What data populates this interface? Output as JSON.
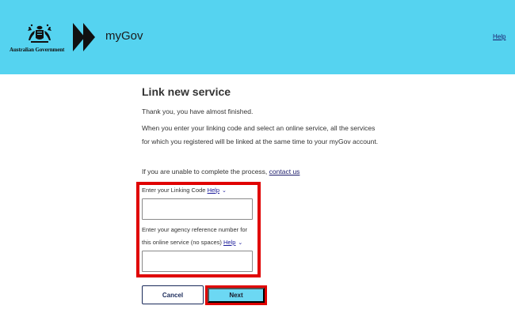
{
  "header": {
    "gov_label": "Australian Government",
    "brand": "myGov",
    "help_label": "Help"
  },
  "main": {
    "title": "Link new service",
    "intro": "Thank you, you have almost finished.",
    "description": "When you enter your linking code and select an online service, all the services for which you registered will be linked at the same time to your myGov account.",
    "unable_text": "If you are unable to complete the process,",
    "contact_label": "contact us"
  },
  "form": {
    "linking_code_label": "Enter your Linking Code",
    "linking_code_help": "Help",
    "linking_code_value": "",
    "agency_ref_label_line1": "Enter your agency reference number for",
    "agency_ref_label_line2": "this online service (no spaces)",
    "agency_ref_help": "Help",
    "agency_ref_value": ""
  },
  "actions": {
    "cancel_label": "Cancel",
    "next_label": "Next"
  },
  "colors": {
    "header_bg": "#55d3f0",
    "highlight": "#e00000",
    "next_bg": "#6cd8f3",
    "link": "#1a1a6a"
  }
}
